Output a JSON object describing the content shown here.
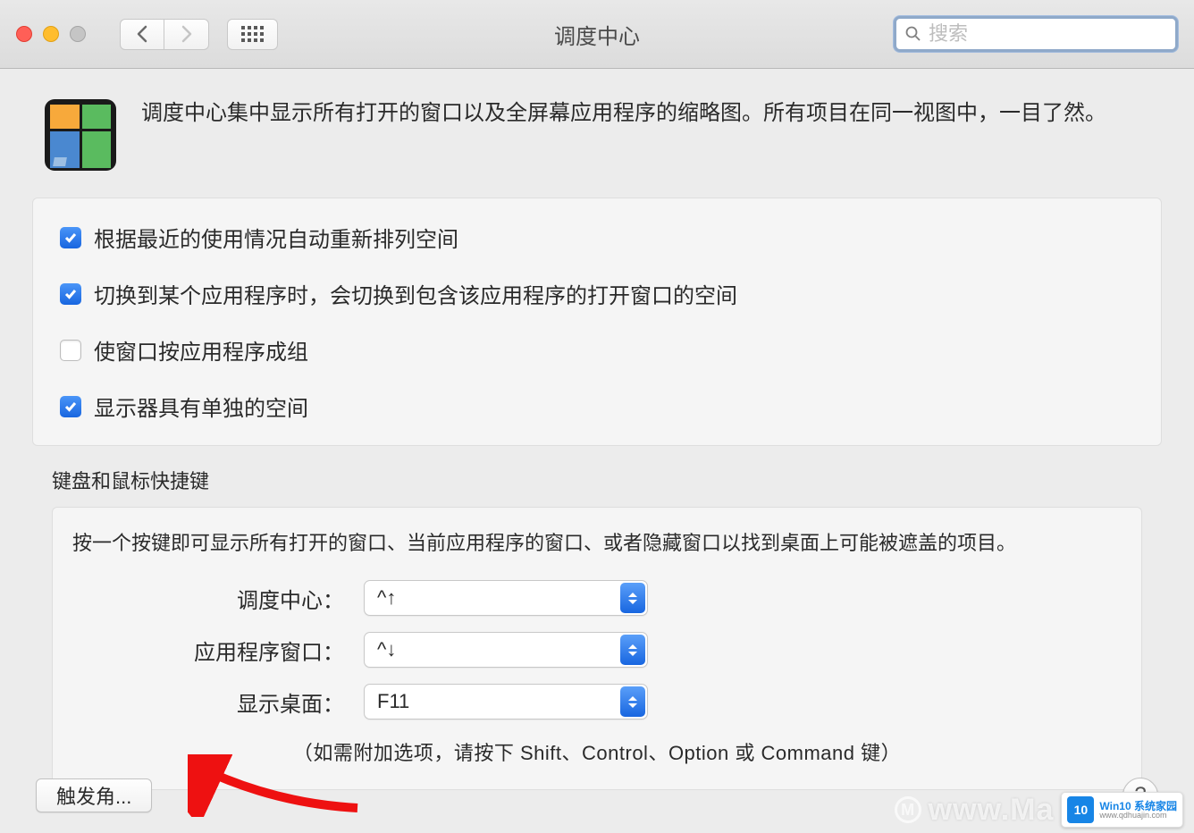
{
  "toolbar": {
    "title": "调度中心",
    "search_placeholder": "搜索"
  },
  "header": {
    "description": "调度中心集中显示所有打开的窗口以及全屏幕应用程序的缩略图。所有项目在同一视图中，一目了然。"
  },
  "options": [
    {
      "label": "根据最近的使用情况自动重新排列空间",
      "checked": true
    },
    {
      "label": "切换到某个应用程序时，会切换到包含该应用程序的打开窗口的空间",
      "checked": true
    },
    {
      "label": "使窗口按应用程序成组",
      "checked": false
    },
    {
      "label": "显示器具有单独的空间",
      "checked": true
    }
  ],
  "shortcuts": {
    "title": "键盘和鼠标快捷键",
    "hint": "按一个按键即可显示所有打开的窗口、当前应用程序的窗口、或者隐藏窗口以找到桌面上可能被遮盖的项目。",
    "rows": [
      {
        "label": "调度中心：",
        "value": "^↑"
      },
      {
        "label": "应用程序窗口：",
        "value": "^↓"
      },
      {
        "label": "显示桌面：",
        "value": "F11"
      }
    ],
    "footer_hint": "（如需附加选项，请按下 Shift、Control、Option 或 Command 键）"
  },
  "buttons": {
    "hot_corners": "触发角...",
    "help": "?"
  },
  "watermark": {
    "text": "www.Ma",
    "badge_title": "Win10 系统家园",
    "badge_sub": "www.qdhuajin.com",
    "badge_num": "10"
  }
}
